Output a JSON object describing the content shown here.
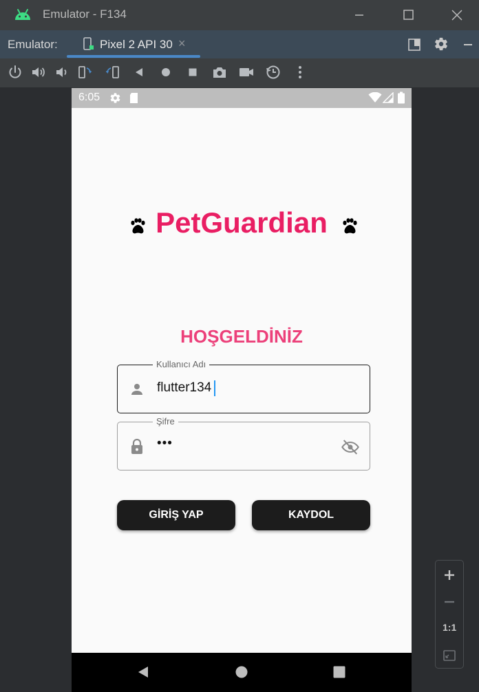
{
  "window": {
    "title": "Emulator - F134"
  },
  "tabbar": {
    "emulator_label": "Emulator:",
    "tab_label": "Pixel 2 API 30",
    "tab_close": "×"
  },
  "toolbar": {
    "icons": [
      "power-icon",
      "volume-up-icon",
      "volume-down-icon",
      "rotate-left-icon",
      "rotate-right-icon",
      "back-icon",
      "home-icon",
      "overview-icon",
      "screenshot-icon",
      "screen-record-icon",
      "snapshot-icon",
      "more-icon"
    ]
  },
  "phone": {
    "status_time": "6:05",
    "app": {
      "title": "PetGuardian",
      "welcome": "HOŞGELDİNİZ",
      "username": {
        "label": "Kullanıcı Adı",
        "value": "flutter134"
      },
      "password": {
        "label": "Şifre",
        "value": "•••"
      },
      "login_button": "GİRİŞ YAP",
      "register_button": "KAYDOL"
    }
  },
  "zoom": {
    "one_to_one": "1:1"
  },
  "colors": {
    "brand": "#e91e63",
    "welcome": "#ec407a",
    "button_bg": "#1c1c1c"
  }
}
